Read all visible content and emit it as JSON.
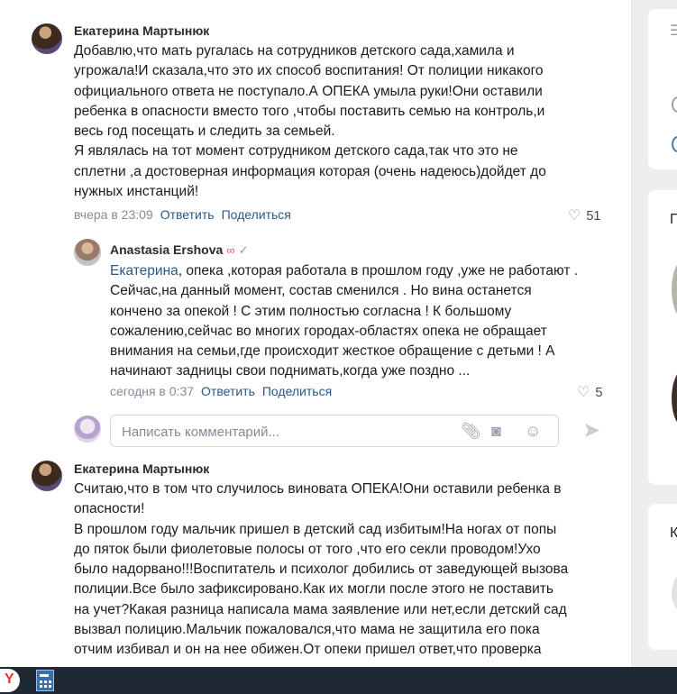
{
  "comments": [
    {
      "author": "Екатерина Мартынюк",
      "text": "Добавлю,что мать ругалась на сотрудников детского сада,хамила и\nугрожала!И сказала,что это их способ воспитания! От полиции никакого\nофициального ответа не поступало.А ОПЕКА умыла руки!Они оставили\nребенка в опасности вместо того ,чтобы поставить семью на контроль,и\nвесь год посещать и следить за семьей.\nЯ являлась на тот момент сотрудником детского сада,так что это не\nсплетни ,а достоверная информация которая (очень надеюсь)дойдет до\nнужных инстанций!",
      "time": "вчера в 23:09",
      "reply_label": "Ответить",
      "share_label": "Поделиться",
      "likes": "51"
    },
    {
      "author": "Anastasia Ershova",
      "mention": "Екатерина",
      "text": ", опека ,которая работала в прошлом году ,уже не работают .\nСейчас,на данный момент, состав сменился . Но вина останется\nкончено за опекой ! С этим полностью согласна ! К большому\nсожалению,сейчас во многих городах-областях опека не обращает\nвнимания на семьи,где происходит жесткое обращение с детьми ! А\nначинают задницы свои поднимать,когда уже поздно ...",
      "time": "сегодня в 0:37",
      "reply_label": "Ответить",
      "share_label": "Поделиться",
      "likes": "5"
    },
    {
      "author": "Екатерина Мартынюк",
      "text": "Считаю,что в том что случилось виновата ОПЕКА!Они оставили ребенка в\nопасности!\nВ прошлом году мальчик пришел в детский сад избитым!На ногах от попы\nдо пяток были фиолетовые полосы от того ,что его секли проводом!Ухо\nбыло надорвано!!!Воспитатель и психолог добились от заведующей вызова\nполиции.Все было зафиксировано.Как их могли после этого не поставить\nна учет?Какая разница написала мама заявление или нет,если детский сад\nвызвал полицию.Мальчик пожаловался,что мама не защитила его пока\nотчим избивал и он на нее обижен.От опеки пришел ответ,что проверка"
    }
  ],
  "composer": {
    "placeholder": "Написать комментарий...",
    "icons": [
      "paperclip-icon",
      "camera-icon",
      "emoji-icon",
      "send-icon"
    ]
  },
  "right_column": {
    "card1_letter": "П",
    "card2_letter": "К"
  },
  "colors": {
    "link": "#2a5885",
    "meta": "#818c99",
    "taskbar": "#1f2933",
    "background": "#edeef0"
  }
}
